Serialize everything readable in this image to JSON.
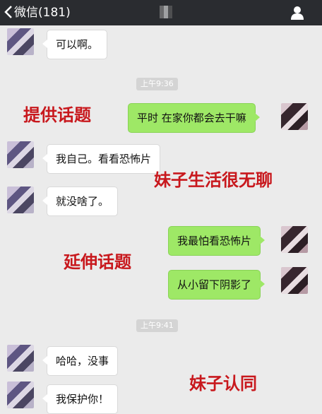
{
  "header": {
    "title": "微信(181)",
    "back_icon": "chevron-left-icon",
    "profile_icon": "person-icon"
  },
  "messages": [
    {
      "side": "left",
      "text": "可以啊。"
    },
    {
      "side": "right",
      "text": "平时 在家你都会去干嘛"
    },
    {
      "side": "left",
      "text": "我自己。看看恐怖片"
    },
    {
      "side": "left",
      "text": "就没啥了。"
    },
    {
      "side": "right",
      "text": "我最怕看恐怖片"
    },
    {
      "side": "right",
      "text": "从小留下阴影了"
    },
    {
      "side": "left",
      "text": "哈哈，没事"
    },
    {
      "side": "left",
      "text": "我保护你！"
    }
  ],
  "timestamps": [
    "上午9:36",
    "上午9:41"
  ],
  "annotations": [
    "提供话题",
    "妹子生活很无聊",
    "延伸话题",
    "妹子认同"
  ],
  "colors": {
    "header_bg": "#2a2c30",
    "chat_bg": "#ebebeb",
    "sent_bubble": "#9ee866",
    "received_bubble": "#ffffff",
    "annotation_red": "#c8181d"
  }
}
